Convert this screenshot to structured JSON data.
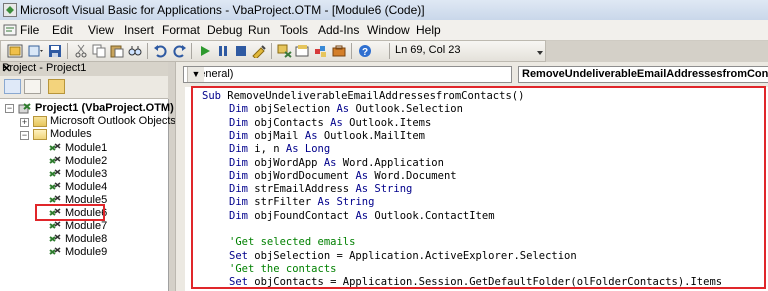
{
  "window": {
    "title": "Microsoft Visual Basic for Applications - VbaProject.OTM - [Module6 (Code)]"
  },
  "menu": [
    "File",
    "Edit",
    "View",
    "Insert",
    "Format",
    "Debug",
    "Run",
    "Tools",
    "Add-Ins",
    "Window",
    "Help"
  ],
  "toolbar": {
    "position": "Ln 69, Col 23"
  },
  "project": {
    "header": "Project - Project1",
    "close": "✕",
    "root": "Project1 (VbaProject.OTM)",
    "outlook_folder": "Microsoft Outlook Objects",
    "modules_folder": "Modules",
    "modules": [
      "Module1",
      "Module2",
      "Module3",
      "Module4",
      "Module5",
      "Module6",
      "Module7",
      "Module8",
      "Module9"
    ],
    "selected_module": "Module6"
  },
  "code": {
    "object_combo": "(General)",
    "proc_combo": "RemoveUndeliverableEmailAddressesfromContacts",
    "lines": [
      {
        "k": "Sub",
        "t": " RemoveUndeliverableEmailAddressesfromContacts()",
        "i": 0
      },
      {
        "k": "Dim",
        "t": " objSelection ",
        "k2": "As",
        "t2": " Outlook.Selection",
        "i": 1
      },
      {
        "k": "Dim",
        "t": " objContacts ",
        "k2": "As",
        "t2": " Outlook.Items",
        "i": 1
      },
      {
        "k": "Dim",
        "t": " objMail ",
        "k2": "As",
        "t2": " Outlook.MailItem",
        "i": 1
      },
      {
        "k": "Dim",
        "t": " i, n ",
        "k2": "As Long",
        "t2": "",
        "i": 1
      },
      {
        "k": "Dim",
        "t": " objWordApp ",
        "k2": "As",
        "t2": " Word.Application",
        "i": 1
      },
      {
        "k": "Dim",
        "t": " objWordDocument ",
        "k2": "As",
        "t2": " Word.Document",
        "i": 1
      },
      {
        "k": "Dim",
        "t": " strEmailAddress ",
        "k2": "As String",
        "t2": "",
        "i": 1
      },
      {
        "k": "Dim",
        "t": " strFilter ",
        "k2": "As String",
        "t2": "",
        "i": 1
      },
      {
        "k": "Dim",
        "t": " objFoundContact ",
        "k2": "As",
        "t2": " Outlook.ContactItem",
        "i": 1
      },
      {
        "k": "",
        "t": "",
        "i": 1
      },
      {
        "c": "'Get selected emails",
        "i": 1
      },
      {
        "k": "Set",
        "t": " objSelection = Application.ActiveExplorer.Selection",
        "i": 1
      },
      {
        "c": "'Get the contacts",
        "i": 1
      },
      {
        "k": "Set",
        "t": " objContacts = Application.Session.GetDefaultFolder(olFolderContacts).Items",
        "i": 1
      }
    ]
  }
}
